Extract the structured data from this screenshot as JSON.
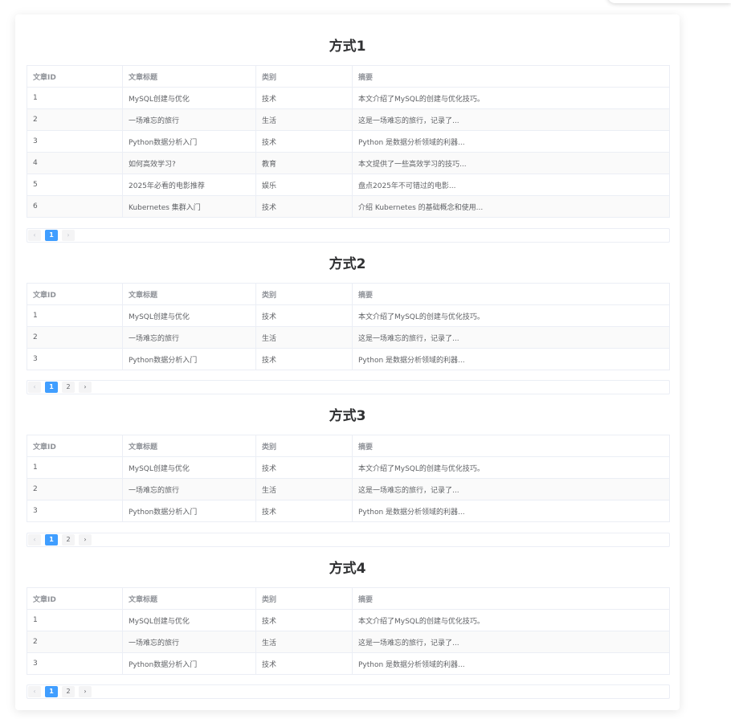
{
  "headers": [
    "文章ID",
    "文章标题",
    "类别",
    "摘要"
  ],
  "sections": [
    {
      "title": "方式1",
      "rows": [
        [
          "1",
          "MySQL创建与优化",
          "技术",
          "本文介绍了MySQL的创建与优化技巧。"
        ],
        [
          "2",
          "一场难忘的旅行",
          "生活",
          "这是一场难忘的旅行，记录了..."
        ],
        [
          "3",
          "Python数据分析入门",
          "技术",
          "Python 是数据分析领域的利器..."
        ],
        [
          "4",
          "如何高效学习?",
          "教育",
          "本文提供了一些高效学习的技巧..."
        ],
        [
          "5",
          "2025年必看的电影推荐",
          "娱乐",
          "盘点2025年不可错过的电影..."
        ],
        [
          "6",
          "Kubernetes 集群入门",
          "技术",
          "介绍 Kubernetes 的基础概念和使用..."
        ]
      ],
      "pagination": {
        "prev": "‹",
        "pages": [
          "1"
        ],
        "next": "›",
        "current": "1"
      }
    },
    {
      "title": "方式2",
      "rows": [
        [
          "1",
          "MySQL创建与优化",
          "技术",
          "本文介绍了MySQL的创建与优化技巧。"
        ],
        [
          "2",
          "一场难忘的旅行",
          "生活",
          "这是一场难忘的旅行，记录了..."
        ],
        [
          "3",
          "Python数据分析入门",
          "技术",
          "Python 是数据分析领域的利器..."
        ]
      ],
      "pagination": {
        "prev": "‹",
        "pages": [
          "1",
          "2"
        ],
        "next": "›",
        "current": "1"
      }
    },
    {
      "title": "方式3",
      "rows": [
        [
          "1",
          "MySQL创建与优化",
          "技术",
          "本文介绍了MySQL的创建与优化技巧。"
        ],
        [
          "2",
          "一场难忘的旅行",
          "生活",
          "这是一场难忘的旅行，记录了..."
        ],
        [
          "3",
          "Python数据分析入门",
          "技术",
          "Python 是数据分析领域的利器..."
        ]
      ],
      "pagination": {
        "prev": "‹",
        "pages": [
          "1",
          "2"
        ],
        "next": "›",
        "current": "1"
      }
    },
    {
      "title": "方式4",
      "rows": [
        [
          "1",
          "MySQL创建与优化",
          "技术",
          "本文介绍了MySQL的创建与优化技巧。"
        ],
        [
          "2",
          "一场难忘的旅行",
          "生活",
          "这是一场难忘的旅行，记录了..."
        ],
        [
          "3",
          "Python数据分析入门",
          "技术",
          "Python 是数据分析领域的利器..."
        ]
      ],
      "pagination": {
        "prev": "‹",
        "pages": [
          "1",
          "2"
        ],
        "next": "›",
        "current": "1"
      }
    }
  ],
  "colors": {
    "accent": "#409eff",
    "header_text": "#909399",
    "body_text": "#606266",
    "title_text": "#303133",
    "border": "#ebeef5",
    "stripe": "#fafafa"
  },
  "icons": {
    "prev": "chevron-left-icon",
    "next": "chevron-right-icon"
  }
}
